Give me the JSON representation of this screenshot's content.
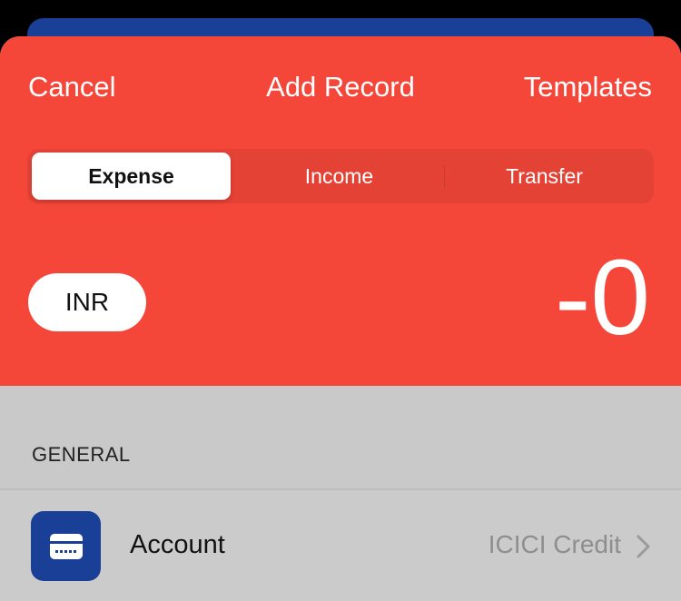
{
  "nav": {
    "cancel_label": "Cancel",
    "title": "Add Record",
    "templates_label": "Templates"
  },
  "record_type_tabs": [
    {
      "label": "Expense",
      "selected": true
    },
    {
      "label": "Income",
      "selected": false
    },
    {
      "label": "Transfer",
      "selected": false
    }
  ],
  "entry": {
    "currency": "INR",
    "amount": "-0"
  },
  "general_section": {
    "label": "GENERAL",
    "rows": [
      {
        "icon": "credit-card-icon",
        "label": "Account",
        "value": "ICICI Credit",
        "chevron_icon": "chevron-right-icon"
      }
    ]
  },
  "colors": {
    "header_red": "#f4473a",
    "account_blue": "#1a3f96",
    "row_gray": "#cbcbcb",
    "value_gray": "#8e8e8e"
  }
}
